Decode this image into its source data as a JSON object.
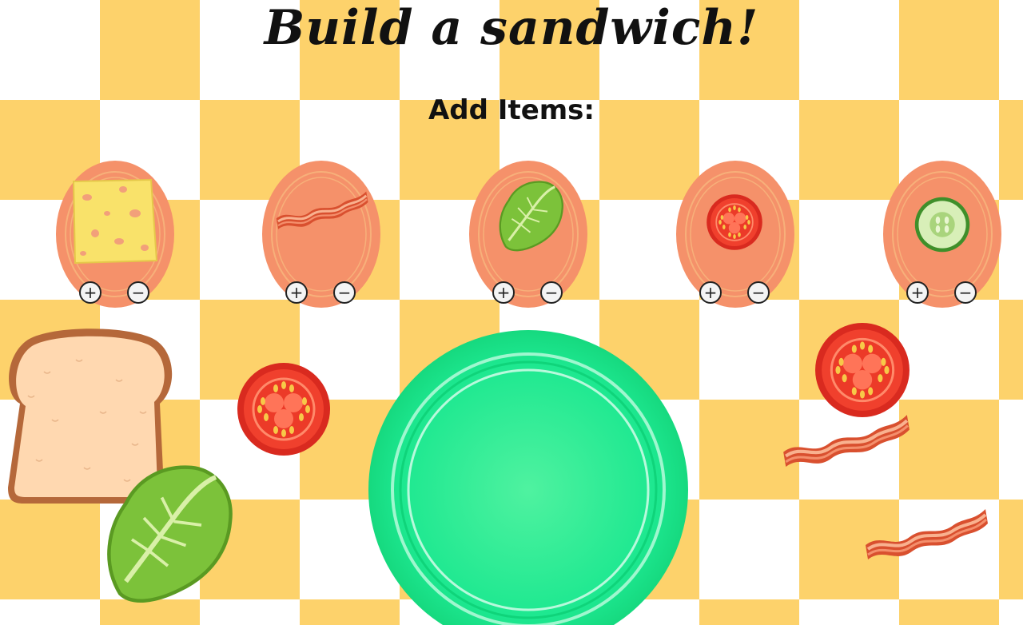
{
  "header": {
    "title": "Build a sandwich!",
    "subtitle": "Add Items:"
  },
  "controls": {
    "plus_symbol": "+",
    "minus_symbol": "−"
  },
  "items": [
    {
      "name": "cheese",
      "icon": "cheese-icon"
    },
    {
      "name": "bacon",
      "icon": "bacon-icon"
    },
    {
      "name": "lettuce",
      "icon": "lettuce-icon"
    },
    {
      "name": "tomato",
      "icon": "tomato-icon"
    },
    {
      "name": "cucumber",
      "icon": "cucumber-icon"
    }
  ],
  "colors": {
    "checker": "#fdd26b",
    "platter": "#f5916a",
    "plate": "#19e88a"
  }
}
